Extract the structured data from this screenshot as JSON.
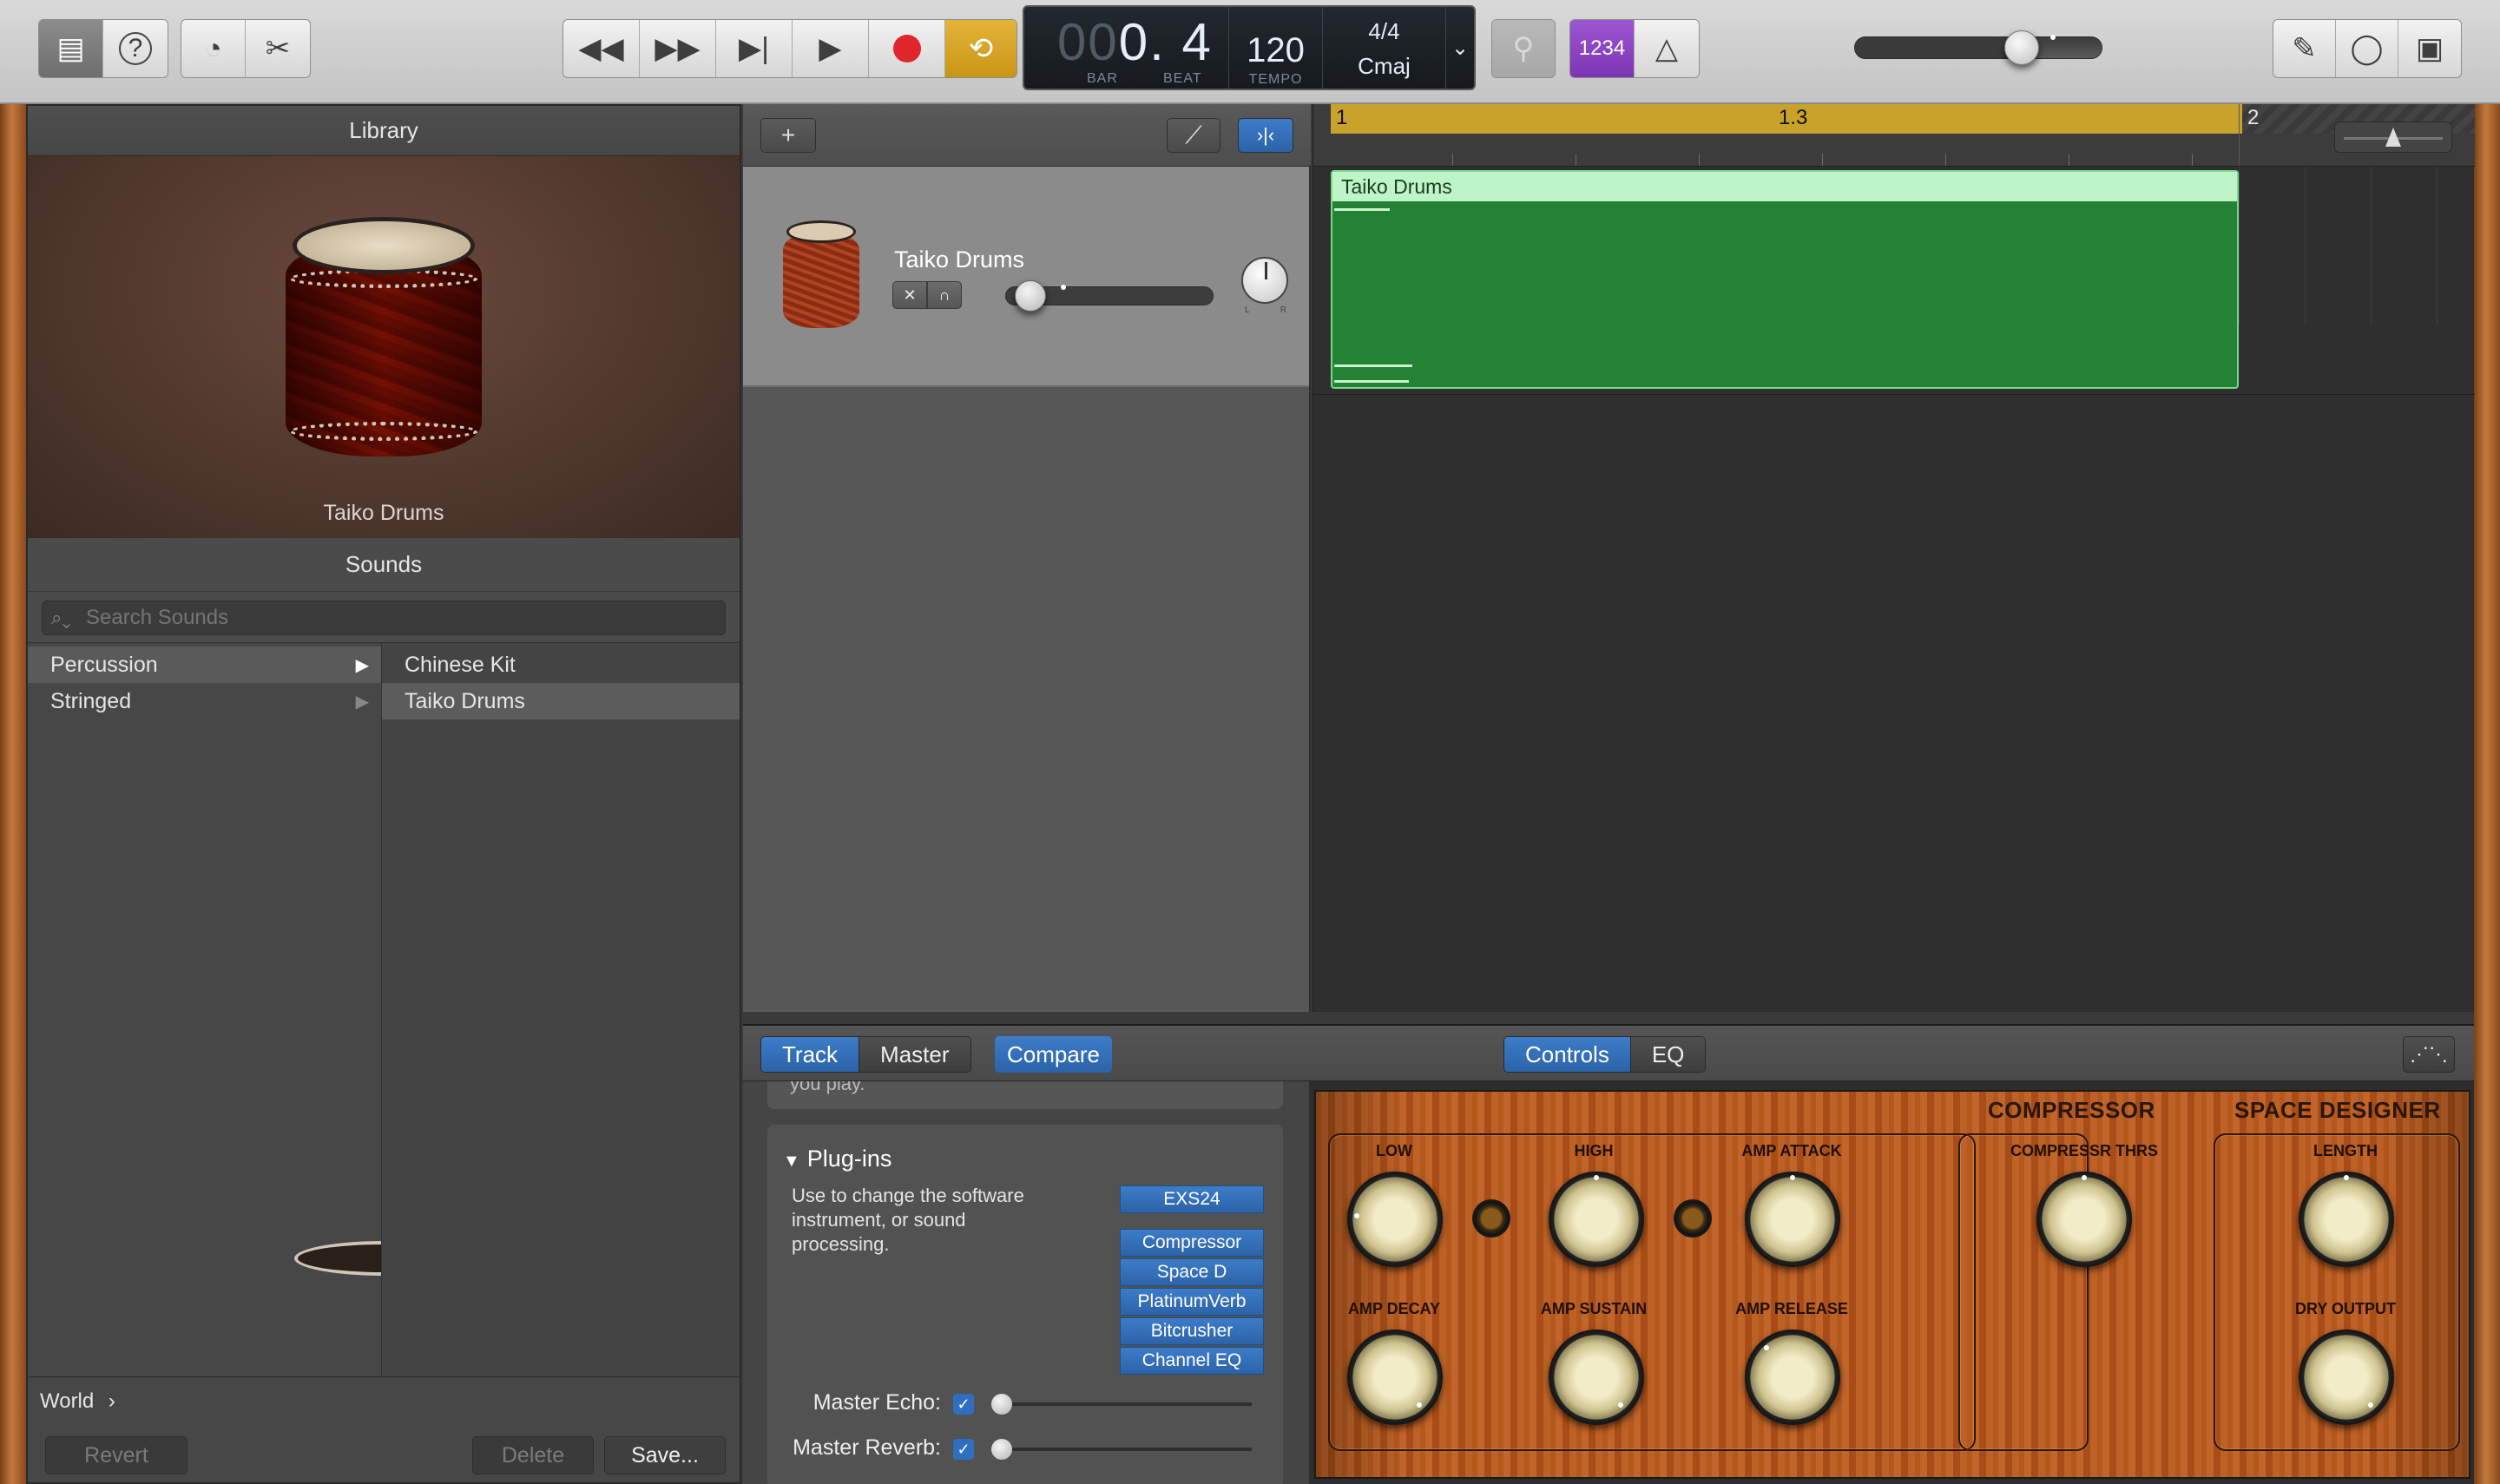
{
  "toolbar": {
    "left_icons": [
      "library-icon",
      "help-icon"
    ],
    "edit_icons": [
      "smart-controls-icon",
      "scissors-icon"
    ],
    "transport": [
      "rewind-icon",
      "fast-forward-icon",
      "go-to-end-icon",
      "play-icon",
      "record-icon",
      "cycle-icon"
    ],
    "lcd": {
      "position_dim": "00",
      "position": "0. 4",
      "bar_label": "BAR",
      "beat_label": "BEAT",
      "tempo": "120",
      "tempo_label": "TEMPO",
      "time_signature": "4/4",
      "key": "Cmaj"
    },
    "count_in_label": "1234",
    "master_volume": 0.7,
    "right_icons": [
      "notepad-icon",
      "loop-browser-icon",
      "media-browser-icon"
    ]
  },
  "library": {
    "title": "Library",
    "selected_instrument": "Taiko Drums",
    "sounds_title": "Sounds",
    "search_placeholder": "Search Sounds",
    "categories": [
      {
        "label": "Percussion",
        "selected": true
      },
      {
        "label": "Stringed",
        "selected": false
      }
    ],
    "items": [
      {
        "label": "Chinese Kit",
        "selected": false
      },
      {
        "label": "Taiko Drums",
        "selected": true
      }
    ],
    "world_label": "World",
    "world_chevron": "›",
    "revert_label": "Revert",
    "delete_label": "Delete",
    "save_label": "Save..."
  },
  "tracks": {
    "add_label": "+",
    "track_name": "Taiko Drums",
    "volume": 0.05,
    "pan_left": "L",
    "pan_right": "R"
  },
  "arrange": {
    "ruler": [
      "1",
      "1.3",
      "2"
    ],
    "region_name": "Taiko Drums",
    "cycle_color": "#c9a22c",
    "region_color": "#248235"
  },
  "inspector": {
    "tabs": [
      "Track",
      "Master"
    ],
    "active_tab": "Track",
    "compare_label": "Compare",
    "view_tabs": [
      "Controls",
      "EQ"
    ],
    "active_view_tab": "Controls",
    "truncated_text": "you play.",
    "plugins_title": "Plug-ins",
    "plugins_desc": "Use to change the software instrument, or sound processing.",
    "instrument_plugin": "EXS24",
    "effect_plugins": [
      "Compressor",
      "Space D",
      "PlatinumVerb",
      "Bitcrusher",
      "Channel EQ"
    ],
    "master_echo_label": "Master Echo:",
    "master_reverb_label": "Master Reverb:"
  },
  "controls": {
    "compressor_title": "COMPRESSOR",
    "space_designer_title": "SPACE DESIGNER",
    "knobs": {
      "low": "LOW",
      "high": "HIGH",
      "amp_attack": "AMP ATTACK",
      "amp_decay": "AMP DECAY",
      "amp_sustain": "AMP SUSTAIN",
      "amp_release": "AMP RELEASE",
      "compressor_threshold": "COMPRESSR THRS",
      "length": "LENGTH",
      "dry_output": "DRY OUTPUT"
    }
  }
}
